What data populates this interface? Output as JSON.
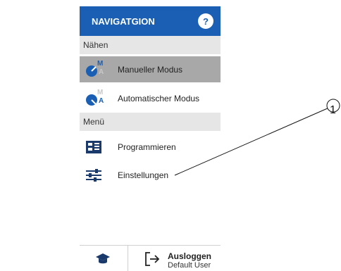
{
  "sidebar": {
    "title": "NAVIGATGION",
    "help_icon": "?",
    "sections": [
      {
        "label": "Nähen"
      },
      {
        "label": "Menü"
      }
    ],
    "items": [
      {
        "label": "Manueller Modus",
        "icon": "manual-mode-icon",
        "active": true,
        "badge_top": "M",
        "badge_bottom": "A"
      },
      {
        "label": "Automatischer Modus",
        "icon": "automatic-mode-icon",
        "active": false,
        "badge_top": "M",
        "badge_bottom": "A"
      },
      {
        "label": "Programmieren",
        "icon": "program-icon",
        "active": false
      },
      {
        "label": "Einstellungen",
        "icon": "settings-sliders-icon",
        "active": false
      }
    ],
    "footer": {
      "left_icon": "graduation-cap-icon",
      "logout_icon": "logout-icon",
      "logout_label": "Ausloggen",
      "user_label": "Default User"
    }
  },
  "callout": {
    "number": "1"
  },
  "colors": {
    "accent": "#1a5fb4",
    "active_bg": "#a8a8a8",
    "section_bg": "#e6e6e6"
  }
}
